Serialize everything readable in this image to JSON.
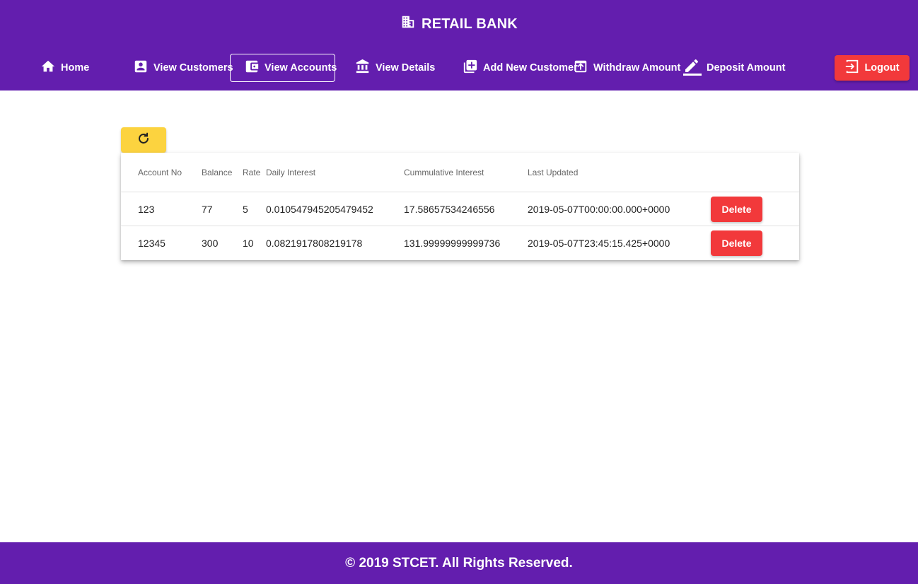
{
  "header": {
    "title": "RETAIL BANK",
    "brand_icon": "bank-building-icon"
  },
  "nav": {
    "items": [
      {
        "label": "Home",
        "icon": "home-icon"
      },
      {
        "label": "View Customers",
        "icon": "contact-card-icon"
      },
      {
        "label": "View Accounts",
        "icon": "wallet-icon",
        "active": true
      },
      {
        "label": "View Details",
        "icon": "bank-icon"
      },
      {
        "label": "Add New Customer",
        "icon": "add-box-icon"
      },
      {
        "label": "Withdraw Amount",
        "icon": "upload-icon"
      },
      {
        "label": "Deposit Amount",
        "icon": "edit-pencil-icon"
      }
    ],
    "logout_label": "Logout"
  },
  "refresh_icon": "refresh-icon",
  "table": {
    "headers": [
      "Account No",
      "Balance",
      "Rate",
      "Daily Interest",
      "Cummulative Interest",
      "Last Updated"
    ],
    "rows": [
      {
        "account_no": "123",
        "balance": "77",
        "rate": "5",
        "daily_interest": "0.010547945205479452",
        "cumulative_interest": "17.58657534246556",
        "last_updated": "2019-05-07T00:00:00.000+0000",
        "action": "Delete"
      },
      {
        "account_no": "12345",
        "balance": "300",
        "rate": "10",
        "daily_interest": "0.0821917808219178",
        "cumulative_interest": "131.99999999999736",
        "last_updated": "2019-05-07T23:45:15.425+0000",
        "action": "Delete"
      }
    ]
  },
  "footer": {
    "text": "© 2019 STCET. All Rights Reserved."
  },
  "colors": {
    "primary": "#631eae",
    "danger": "#f2393b",
    "warning": "#fcd33f"
  }
}
